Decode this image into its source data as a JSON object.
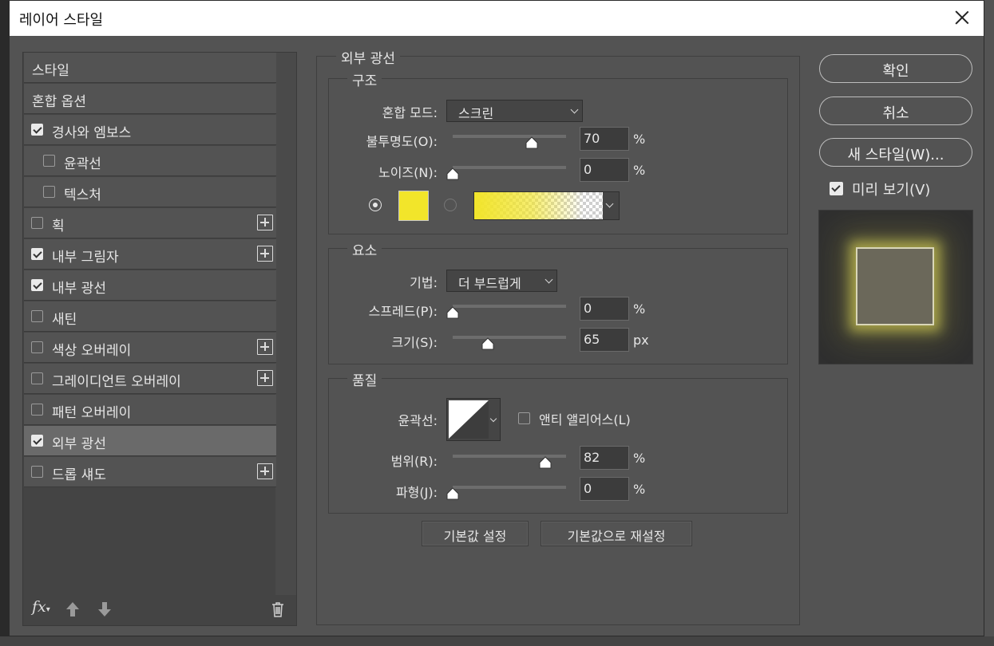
{
  "dialog": {
    "title": "레이어 스타일"
  },
  "style_list": {
    "items": [
      {
        "label": "스타일",
        "checkbox": false,
        "checked": false,
        "plus": false,
        "selected": false,
        "indent": false
      },
      {
        "label": "혼합 옵션",
        "checkbox": false,
        "checked": false,
        "plus": false,
        "selected": false,
        "indent": false
      },
      {
        "label": "경사와 엠보스",
        "checkbox": true,
        "checked": true,
        "plus": false,
        "selected": false,
        "indent": false
      },
      {
        "label": "윤곽선",
        "checkbox": true,
        "checked": false,
        "plus": false,
        "selected": false,
        "indent": true
      },
      {
        "label": "텍스처",
        "checkbox": true,
        "checked": false,
        "plus": false,
        "selected": false,
        "indent": true
      },
      {
        "label": "획",
        "checkbox": true,
        "checked": false,
        "plus": true,
        "selected": false,
        "indent": false
      },
      {
        "label": "내부 그림자",
        "checkbox": true,
        "checked": true,
        "plus": true,
        "selected": false,
        "indent": false
      },
      {
        "label": "내부 광선",
        "checkbox": true,
        "checked": true,
        "plus": false,
        "selected": false,
        "indent": false
      },
      {
        "label": "새틴",
        "checkbox": true,
        "checked": false,
        "plus": false,
        "selected": false,
        "indent": false
      },
      {
        "label": "색상 오버레이",
        "checkbox": true,
        "checked": false,
        "plus": true,
        "selected": false,
        "indent": false
      },
      {
        "label": "그레이디언트 오버레이",
        "checkbox": true,
        "checked": false,
        "plus": true,
        "selected": false,
        "indent": false
      },
      {
        "label": "패턴 오버레이",
        "checkbox": true,
        "checked": false,
        "plus": false,
        "selected": false,
        "indent": false
      },
      {
        "label": "외부 광선",
        "checkbox": true,
        "checked": true,
        "plus": false,
        "selected": true,
        "indent": false
      },
      {
        "label": "드롭 섀도",
        "checkbox": true,
        "checked": false,
        "plus": true,
        "selected": false,
        "indent": false
      }
    ],
    "footer": {
      "fx_label": "fx"
    }
  },
  "outer_glow": {
    "title": "외부 광선",
    "structure": {
      "title": "구조",
      "blend_mode_label": "혼합 모드:",
      "blend_mode_value": "스크린",
      "opacity_label": "불투명도(O):",
      "opacity_value": "70",
      "opacity_fraction": 0.7,
      "opacity_unit": "%",
      "noise_label": "노이즈(N):",
      "noise_value": "0",
      "noise_fraction": 0.0,
      "noise_unit": "%",
      "color_mode": "solid",
      "glow_color": "#f2e52a"
    },
    "elements": {
      "title": "요소",
      "technique_label": "기법:",
      "technique_value": "더 부드럽게",
      "spread_label": "스프레드(P):",
      "spread_value": "0",
      "spread_fraction": 0.0,
      "spread_unit": "%",
      "size_label": "크기(S):",
      "size_value": "65",
      "size_fraction": 0.31,
      "size_unit": "px"
    },
    "quality": {
      "title": "품질",
      "contour_label": "윤곽선:",
      "antialias_label": "앤티 앨리어스(L)",
      "antialias_checked": false,
      "range_label": "범위(R):",
      "range_value": "82",
      "range_fraction": 0.82,
      "range_unit": "%",
      "jitter_label": "파형(J):",
      "jitter_value": "0",
      "jitter_fraction": 0.0,
      "jitter_unit": "%"
    },
    "buttons": {
      "make_default": "기본값 설정",
      "reset_default": "기본값으로 재설정"
    }
  },
  "side_buttons": {
    "ok": "확인",
    "cancel": "취소",
    "new_style": "새 스타일(W)...",
    "preview_label": "미리 보기(V)",
    "preview_checked": true
  }
}
